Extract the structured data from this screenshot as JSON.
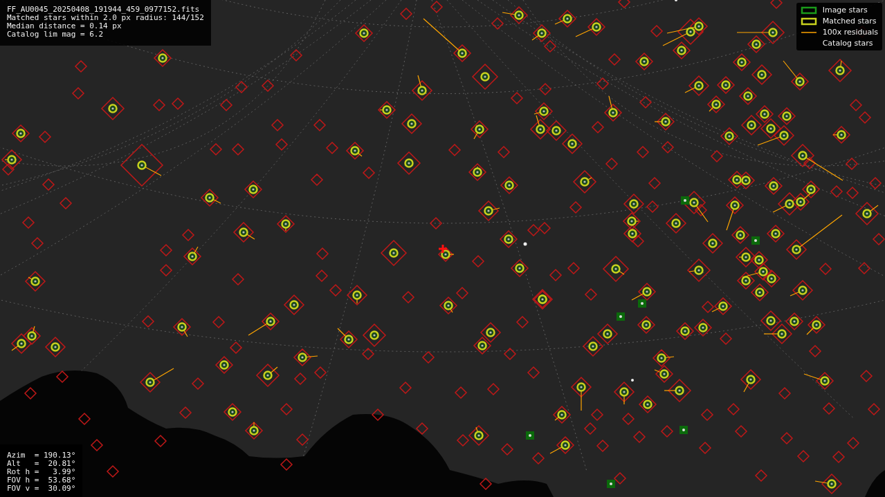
{
  "file_info": {
    "lines": [
      "FF_AU0045_20250408_191944_459_0977152.fits",
      "Matched stars within 2.0 px radius: 144/152",
      "Median distance = 0.14 px",
      "Catalog lim mag = 6.2"
    ]
  },
  "pointing": {
    "lines": [
      "Azim  = 190.13°",
      "Alt   =  20.81°",
      "Rot h =   3.99°",
      "FOV h =  53.68°",
      "FOV v =  30.09°"
    ]
  },
  "legend": [
    {
      "label": "Image stars",
      "kind": "image"
    },
    {
      "label": "Matched stars",
      "kind": "matched"
    },
    {
      "label": "100x residuals",
      "kind": "residual"
    },
    {
      "label": "Catalog stars",
      "kind": "catalog"
    }
  ]
}
